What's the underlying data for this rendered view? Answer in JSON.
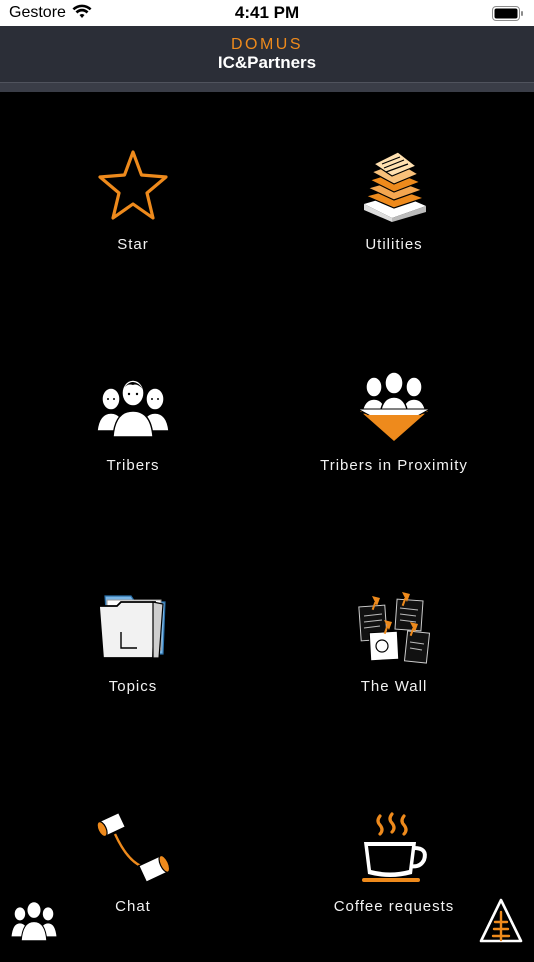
{
  "status_bar": {
    "carrier": "Gestore",
    "time": "4:41 PM"
  },
  "header": {
    "subtitle": "DOMUS",
    "title": "IC&Partners"
  },
  "menu": {
    "items": [
      {
        "label": "Star",
        "icon": "star-icon"
      },
      {
        "label": "Utilities",
        "icon": "papers-stack-icon"
      },
      {
        "label": "Tribers",
        "icon": "people-group-icon"
      },
      {
        "label": "Tribers in Proximity",
        "icon": "people-funnel-icon"
      },
      {
        "label": "Topics",
        "icon": "folder-icon"
      },
      {
        "label": "The Wall",
        "icon": "pinned-notes-icon"
      },
      {
        "label": "Chat",
        "icon": "tin-can-phone-icon"
      },
      {
        "label": "Coffee requests",
        "icon": "coffee-cup-icon"
      }
    ]
  },
  "colors": {
    "accent": "#ee8a1c",
    "navbar": "#2b2e37",
    "background": "#000000"
  }
}
